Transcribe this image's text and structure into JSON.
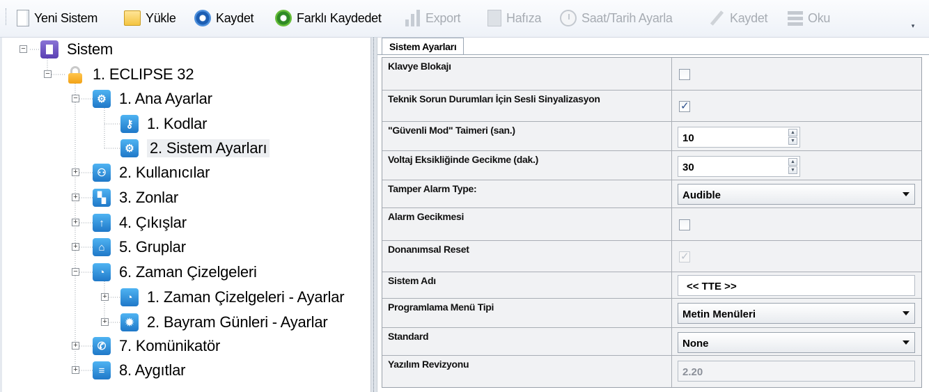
{
  "toolbar": {
    "items": [
      {
        "label": "Yeni Sistem",
        "icon": "new-document-icon",
        "enabled": true
      },
      {
        "label": "Yükle",
        "icon": "folder-open-icon",
        "enabled": true
      },
      {
        "label": "Kaydet",
        "icon": "save-disk-icon",
        "enabled": true
      },
      {
        "label": "Farklı Kaydedet",
        "icon": "save-as-disk-icon",
        "enabled": true
      },
      {
        "label": "Export",
        "icon": "bar-chart-icon",
        "enabled": false
      },
      {
        "label": "Hafıza",
        "icon": "memory-chip-icon",
        "enabled": false
      },
      {
        "label": "Saat/Tarih Ayarla",
        "icon": "clock-icon",
        "enabled": false
      },
      {
        "label": "Kaydet",
        "icon": "pencil-icon",
        "enabled": false
      },
      {
        "label": "Oku",
        "icon": "memory-stack-icon",
        "enabled": false
      }
    ]
  },
  "tree": {
    "root": "Sistem",
    "panel": "1. ECLIPSE 32",
    "ana_ayarlar": "1. Ana Ayarlar",
    "kodlar": "1. Kodlar",
    "sistem_ayarlari": "2. Sistem Ayarları",
    "kullanicilar": "2. Kullanıcılar",
    "zonlar": "3. Zonlar",
    "cikislar": "4. Çıkışlar",
    "gruplar": "5. Gruplar",
    "zaman_cizelgeleri": "6. Zaman Çizelgeleri",
    "zaman_ayarlar": "1. Zaman Çizelgeleri - Ayarlar",
    "bayram_gunleri": "2. Bayram Günleri - Ayarlar",
    "komunikator": "7. Komünikatör",
    "aygitlar": "8. Aygıtlar"
  },
  "tab": {
    "label": "Sistem Ayarları"
  },
  "settings": {
    "klavye_blokaji": {
      "label": "Klavye Blokajı",
      "checked": false
    },
    "sesli_sinyal": {
      "label": "Teknik Sorun Durumları İçin Sesli Sinyalizasyon",
      "checked": true
    },
    "guvenli_mod": {
      "label": "\"Güvenli Mod\" Taimeri (san.)",
      "value": "10"
    },
    "voltaj": {
      "label": "Voltaj Eksikliğinde Gecikme (dak.)",
      "value": "30"
    },
    "tamper": {
      "label": "Tamper Alarm Type:",
      "value": "Audible"
    },
    "alarm_gecikmesi": {
      "label": "Alarm Gecikmesi",
      "checked": false
    },
    "donanimsal_reset": {
      "label": "Donanımsal Reset",
      "checked": true,
      "enabled": false
    },
    "sistem_adi": {
      "label": "Sistem Adı",
      "value": "<<  TTE  >>"
    },
    "menu_tipi": {
      "label": "Programlama Menü Tipi",
      "value": "Metin Menüleri"
    },
    "standard": {
      "label": "Standard",
      "value": "None"
    },
    "yazilim": {
      "label": "Yazılım Revizyonu",
      "value": "2.20"
    }
  }
}
